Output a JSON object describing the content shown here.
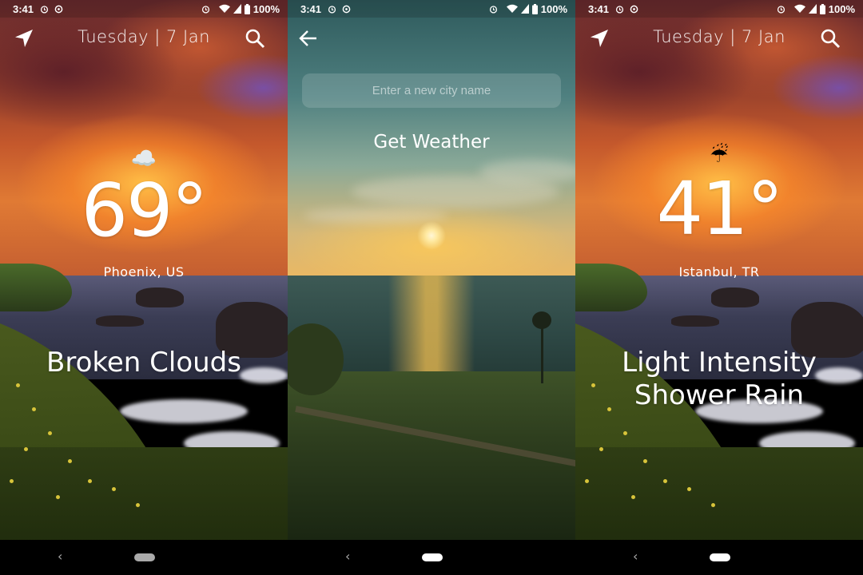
{
  "screens": [
    {
      "status": {
        "time": "3:41",
        "battery": "100%"
      },
      "date": "Tuesday | 7 Jan",
      "temperature": "69°",
      "condition_icon": "☁️",
      "city": "Phoenix, US",
      "description": "Broken Clouds"
    },
    {
      "status": {
        "time": "3:41",
        "battery": "100%"
      },
      "search_placeholder": "Enter a new city name",
      "search_value": "",
      "button_label": "Get Weather"
    },
    {
      "status": {
        "time": "3:41",
        "battery": "100%"
      },
      "date": "Tuesday | 7 Jan",
      "temperature": "41°",
      "condition_icon": "☔",
      "city": "Istanbul, TR",
      "description": "Light Intensity Shower Rain"
    }
  ],
  "colors": {
    "text": "#ffffff",
    "home_pill_inactive": "#aaaaaa",
    "home_pill_active": "#ffffff"
  },
  "icons": {
    "location": "location-arrow-icon",
    "search": "search-icon",
    "back": "arrow-left-icon"
  }
}
